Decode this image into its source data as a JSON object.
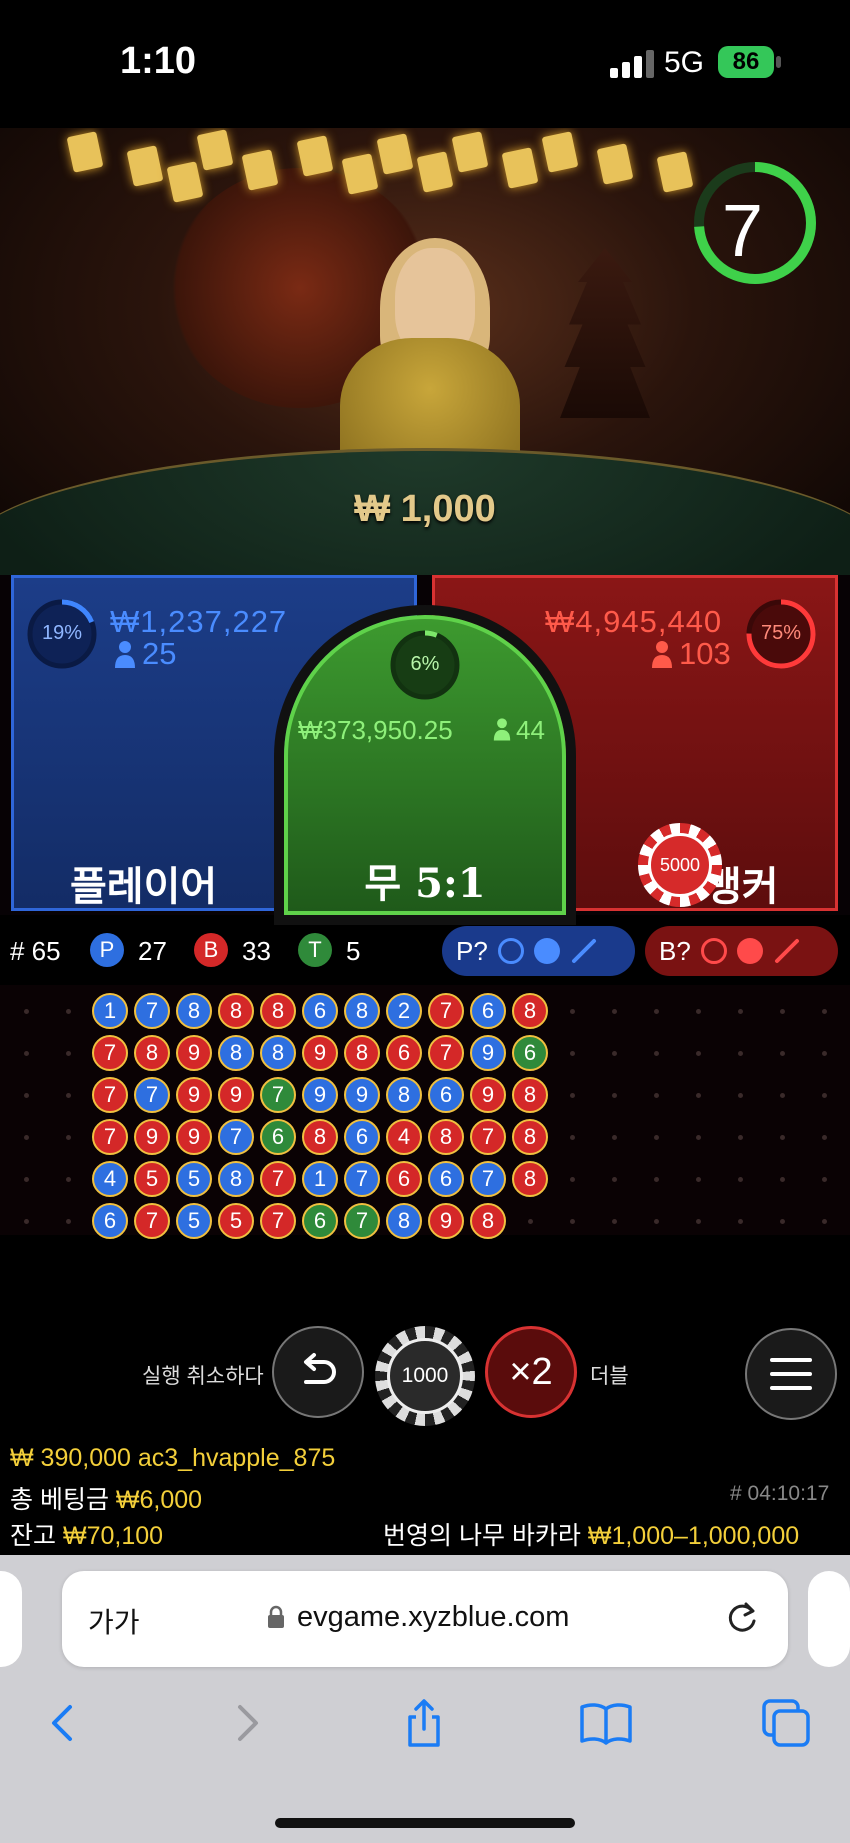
{
  "status_bar": {
    "time": "1:10",
    "network": "5G",
    "battery": "86"
  },
  "video": {
    "min_bet": "₩ 1,000",
    "countdown": "7"
  },
  "bets": {
    "player": {
      "percent": "19%",
      "amount": "₩1,237,227",
      "players": "25",
      "label": "플레이어"
    },
    "tie": {
      "percent": "6%",
      "amount": "₩373,950.25",
      "players": "44",
      "label": "무 5:1"
    },
    "banker": {
      "percent": "75%",
      "amount": "₩4,945,440",
      "players": "103",
      "label": "뱅커",
      "chip": "5000"
    }
  },
  "stats": {
    "round": "# 65",
    "p_label": "P",
    "p_count": "27",
    "b_label": "B",
    "b_count": "33",
    "t_label": "T",
    "t_count": "5",
    "predict_player": "P?",
    "predict_banker": "B?"
  },
  "roadmap": {
    "columns": [
      [
        "P1",
        "B7",
        "B7",
        "B7",
        "P4",
        "P6"
      ],
      [
        "P7",
        "B8",
        "P7",
        "B9",
        "B5",
        "B7"
      ],
      [
        "P8",
        "B9",
        "B9",
        "B9",
        "P5",
        "P5"
      ],
      [
        "B8",
        "P8",
        "B9",
        "P7",
        "P8",
        "B5"
      ],
      [
        "B8",
        "P8",
        "T7",
        "T6",
        "B7",
        "B7"
      ],
      [
        "P6",
        "B9",
        "P9",
        "B8",
        "P1",
        "T6"
      ],
      [
        "P8",
        "B8",
        "P9",
        "P6",
        "P7",
        "T7"
      ],
      [
        "P2",
        "B6",
        "P8",
        "B4",
        "B6",
        "P8"
      ],
      [
        "B7",
        "B7",
        "P6",
        "B8",
        "P6",
        "B9"
      ],
      [
        "P6",
        "P9",
        "B9",
        "B7",
        "P7",
        "B8"
      ],
      [
        "B8",
        "T6",
        "B8",
        "B8",
        "B8",
        ""
      ]
    ]
  },
  "controls": {
    "undo_label": "실행 취소하다",
    "chip_value": "1000",
    "double_symbol": "×2",
    "double_label": "더블"
  },
  "info": {
    "last_win": "₩ 390,000 ac3_hvapple_875",
    "total_bet_label": "총 베팅금",
    "total_bet": "₩6,000",
    "balance_label": "잔고",
    "balance": "₩70,100",
    "game_id": "# 04:10:17",
    "table_name": "번영의 나무 바카라",
    "limits": "₩1,000–1,000,000"
  },
  "browser": {
    "aa": "가가",
    "url": "evgame.xyzblue.com"
  },
  "colors": {
    "player": "#2e6fe0",
    "banker": "#d42828",
    "tie": "#2f8a3a",
    "gold": "#f3cf3a"
  }
}
